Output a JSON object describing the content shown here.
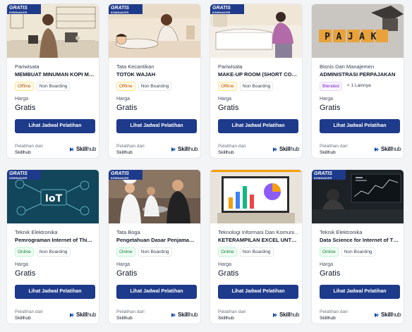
{
  "common": {
    "price_label": "Harga",
    "price": "Gratis",
    "button_label": "Lihat Jadwal Pelatihan",
    "provider_label": "Pelatihan dari",
    "provider": "Skillhub",
    "logo_bold": "Skill",
    "logo_light": "hub",
    "gratis_badge": "GRATIS",
    "gratis_badge_sub": "KEMNAKER"
  },
  "courses": [
    {
      "category": "Pariwisata",
      "title": "MEMBUAT MINUMAN KOPI ME...",
      "tags": [
        "Offline",
        "Non Boarding"
      ],
      "gratis_badge": true
    },
    {
      "category": "Tata Kecantikan",
      "title": "TOTOK WAJAH",
      "tags": [
        "Offline",
        "Non Boarding"
      ],
      "gratis_badge": true
    },
    {
      "category": "Pariwisata",
      "title": "MAKE-UP ROOM (SHORT COU...",
      "tags": [
        "Offline",
        "Non Boarding"
      ],
      "gratis_badge": true
    },
    {
      "category": "Bisnis Dan Manajemen",
      "title": "ADMINISTRASI PERPAJAKAN",
      "tags": [
        "Blended",
        "+ 1 Lainnya"
      ],
      "gratis_badge": false,
      "thumb_text": "PAJAK"
    },
    {
      "category": "Teknik Elektronika",
      "title": "Pemrograman Internet of Thing...",
      "tags": [
        "Online",
        "Non Boarding"
      ],
      "gratis_badge": true,
      "thumb_text": "IoT"
    },
    {
      "category": "Tata Boga",
      "title": "Pengetahuan Dasar Penjamah ...",
      "tags": [
        "Online",
        "Non Boarding"
      ],
      "gratis_badge": true
    },
    {
      "category": "Teknologi Informasi Dan Komuni...",
      "title": "KETERAMPILAN EXCEL UNTUK...",
      "tags": [
        "Online",
        "Non Boarding"
      ],
      "gratis_badge": false
    },
    {
      "category": "Teknik Elektronika",
      "title": "Data Science for Internet of Thi...",
      "tags": [
        "Online",
        "Non Boarding"
      ],
      "gratis_badge": true
    }
  ],
  "colors": {
    "primary": "#1e3a8a",
    "accent": "#f59e0b",
    "online": "#15803d",
    "offline": "#b45309",
    "blended": "#7e22ce"
  }
}
